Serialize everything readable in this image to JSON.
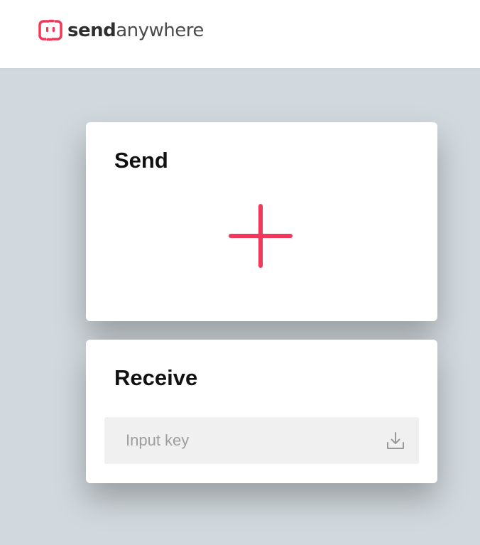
{
  "header": {
    "logo": {
      "name_bold": "send",
      "name_light": "anywhere",
      "icon": "sendanywhere-logo-icon",
      "color": "#f2385a"
    }
  },
  "send_card": {
    "title": "Send",
    "add_icon": "plus-icon",
    "accent_color": "#f2385a"
  },
  "receive_card": {
    "title": "Receive",
    "input": {
      "value": "",
      "placeholder": "Input key"
    },
    "download_icon": "download-icon"
  }
}
